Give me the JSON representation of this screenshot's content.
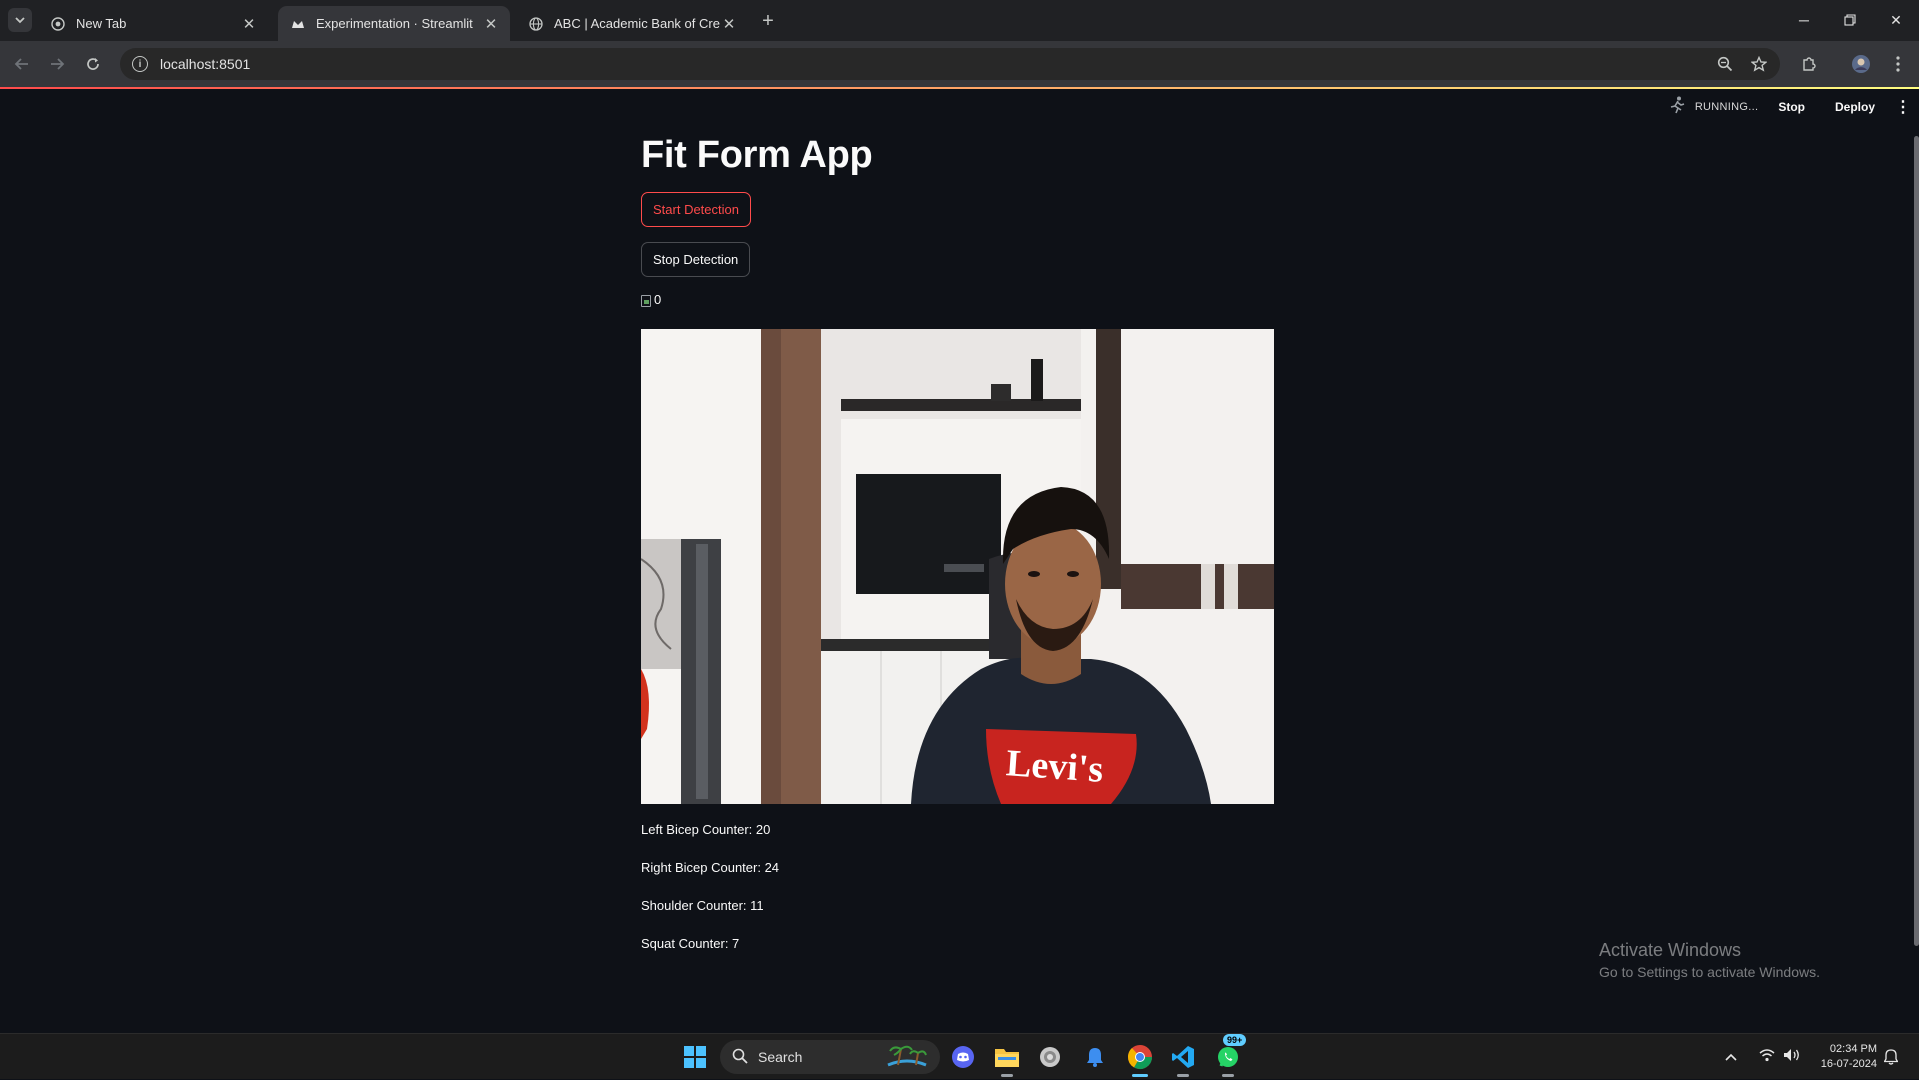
{
  "browser": {
    "tabs": [
      {
        "title": "New Tab"
      },
      {
        "title": "Experimentation · Streamlit"
      },
      {
        "title": "ABC | Academic Bank of Credits"
      }
    ],
    "url": "localhost:8501"
  },
  "streamlit_header": {
    "status": "RUNNING...",
    "stop_label": "Stop",
    "deploy_label": "Deploy"
  },
  "app": {
    "title": "Fit Form App",
    "start_button": "Start Detection",
    "stop_button": "Stop Detection",
    "broken_image_alt": "0",
    "counters": [
      "Left Bicep Counter: 20",
      "Right Bicep Counter: 24",
      "Shoulder Counter: 11",
      "Squat Counter: 7"
    ]
  },
  "camera": {
    "shirt_text": "Levi's"
  },
  "watermark": {
    "line1": "Activate Windows",
    "line2": "Go to Settings to activate Windows."
  },
  "taskbar": {
    "search_placeholder": "Search",
    "whatsapp_badge": "99+",
    "time": "02:34 PM",
    "date": "16-07-2024"
  },
  "colors": {
    "accent": "#ff4b4b",
    "background": "#0e1117",
    "text": "#fafafa"
  }
}
